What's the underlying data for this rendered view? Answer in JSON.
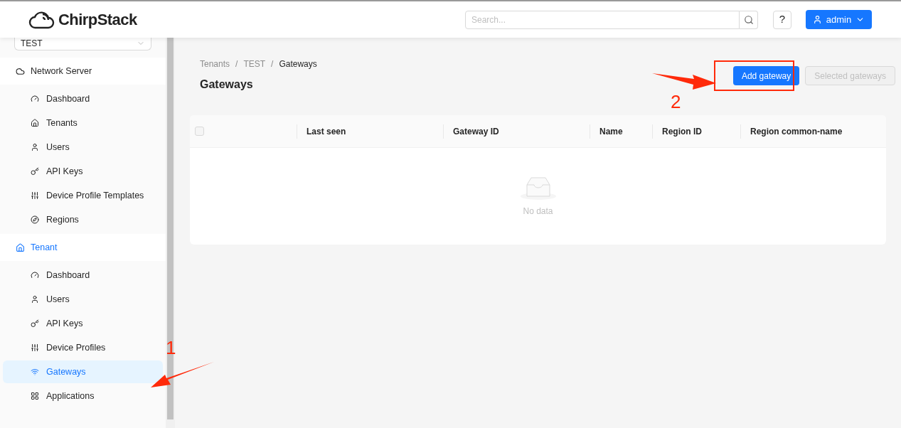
{
  "header": {
    "logo_text": "ChirpStack",
    "search": {
      "placeholder": "Search..."
    },
    "help_label": "?",
    "user_label": "admin"
  },
  "sidebar": {
    "tenant_select": "TEST",
    "groups": [
      {
        "label": "Network Server",
        "active": false,
        "items": [
          {
            "label": "Dashboard",
            "selected": false
          },
          {
            "label": "Tenants",
            "selected": false
          },
          {
            "label": "Users",
            "selected": false
          },
          {
            "label": "API Keys",
            "selected": false
          },
          {
            "label": "Device Profile Templates",
            "selected": false
          },
          {
            "label": "Regions",
            "selected": false
          }
        ]
      },
      {
        "label": "Tenant",
        "active": true,
        "items": [
          {
            "label": "Dashboard",
            "selected": false
          },
          {
            "label": "Users",
            "selected": false
          },
          {
            "label": "API Keys",
            "selected": false
          },
          {
            "label": "Device Profiles",
            "selected": false
          },
          {
            "label": "Gateways",
            "selected": true
          },
          {
            "label": "Applications",
            "selected": false
          }
        ]
      }
    ]
  },
  "breadcrumb": [
    "Tenants",
    "TEST",
    "Gateways"
  ],
  "breadcrumb_separator": "/",
  "page_title": "Gateways",
  "actions": [
    {
      "label": "Add gateway",
      "disabled": false
    },
    {
      "label": "Selected gateways",
      "disabled": true
    }
  ],
  "table": {
    "select_all_checked": false,
    "columns": [
      "Last seen",
      "Gateway ID",
      "Name",
      "Region ID",
      "Region common-name"
    ],
    "empty_text": "No data"
  },
  "annotations": [
    {
      "label": "1"
    },
    {
      "label": "2"
    }
  ]
}
